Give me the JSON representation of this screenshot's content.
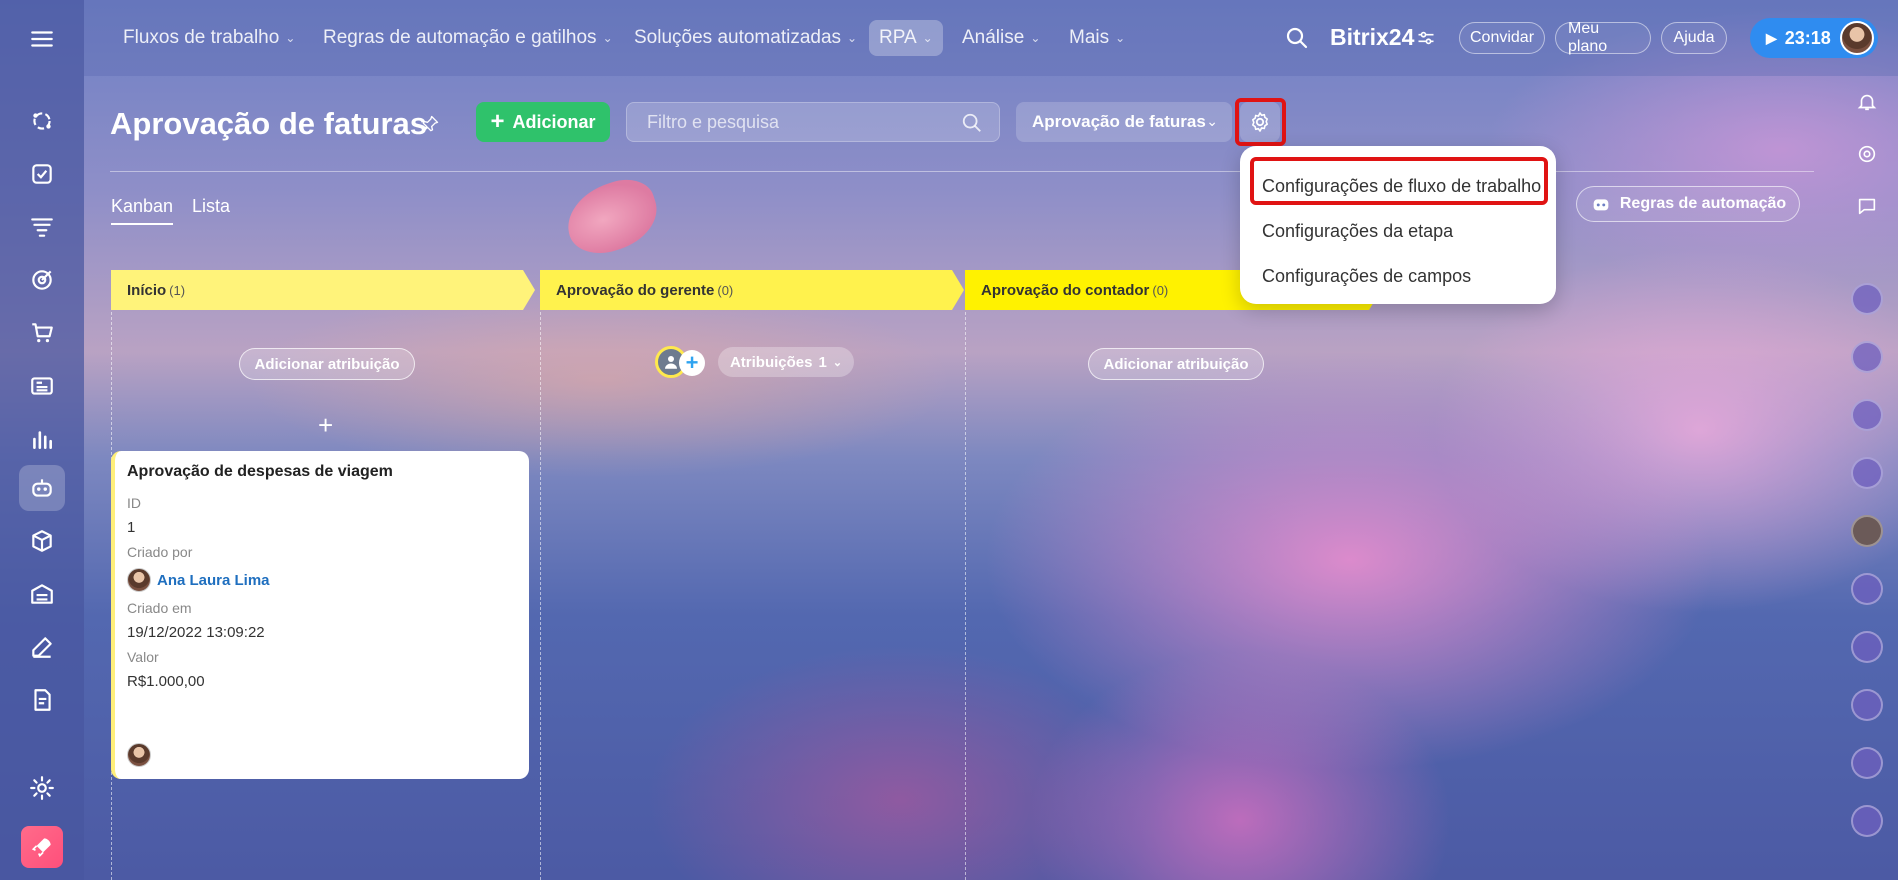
{
  "topnav": {
    "items": [
      {
        "label": "Fluxos de trabalho"
      },
      {
        "label": "Regras de automação e gatilhos"
      },
      {
        "label": "Soluções automatizadas"
      },
      {
        "label": "RPA"
      },
      {
        "label": "Análise"
      },
      {
        "label": "Mais"
      }
    ],
    "brand": "Bitrix24",
    "invite": "Convidar",
    "my_plan": "Meu plano",
    "help": "Ajuda",
    "time": "23:18"
  },
  "page": {
    "title": "Aprovação de faturas",
    "add_label": "Adicionar",
    "search_placeholder": "Filtro e pesquisa",
    "flow_select": "Aprovação de faturas"
  },
  "views": {
    "kanban": "Kanban",
    "list": "Lista",
    "automation_rules": "Regras de automação"
  },
  "settings_menu": {
    "items": [
      "Configurações de fluxo de trabalho",
      "Configurações da etapa",
      "Configurações de campos"
    ]
  },
  "stages": [
    {
      "name": "Início",
      "count": "(1)",
      "color": "#fff37a"
    },
    {
      "name": "Aprovação do gerente",
      "count": "(0)",
      "color": "#fff24d"
    },
    {
      "name": "Aprovação do contador",
      "count": "(0)",
      "color": "#fff200"
    }
  ],
  "columns": {
    "add_assignment": "Adicionar atribuição",
    "assignments_label": "Atribuições",
    "assignments_count": "1"
  },
  "card": {
    "title": "Aprovação de despesas de viagem",
    "id_label": "ID",
    "id_value": "1",
    "created_by_label": "Criado por",
    "created_by_value": "Ana Laura Lima",
    "created_at_label": "Criado em",
    "created_at_value": "19/12/2022 13:09:22",
    "value_label": "Valor",
    "value_value": "R$1.000,00"
  },
  "colors": {
    "add_button": "#2fc26b",
    "highlight": "#e01313",
    "time_button": "#2f8cf0"
  }
}
